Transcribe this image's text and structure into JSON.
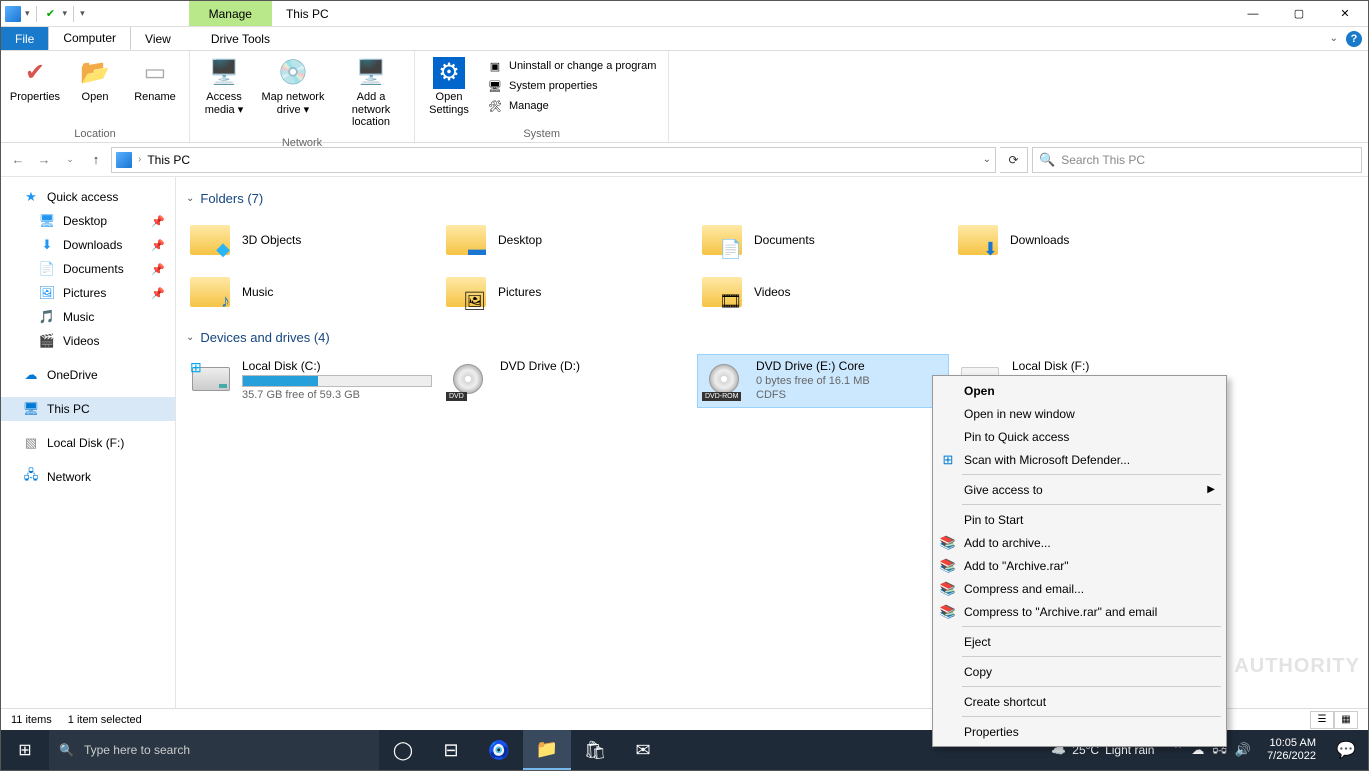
{
  "titlebar": {
    "manage": "Manage",
    "title": "This PC",
    "min": "—",
    "max": "▢",
    "close": "✕"
  },
  "tabs": {
    "file": "File",
    "computer": "Computer",
    "view": "View",
    "drivetools": "Drive Tools"
  },
  "ribbon": {
    "location": {
      "properties": "Properties",
      "open": "Open",
      "rename": "Rename",
      "label": "Location"
    },
    "network": {
      "access_media": "Access media ▾",
      "map_drive": "Map network drive ▾",
      "add_loc": "Add a network location",
      "label": "Network"
    },
    "settings": {
      "open_settings": "Open Settings"
    },
    "system": {
      "uninstall": "Uninstall or change a program",
      "props": "System properties",
      "manage": "Manage",
      "label": "System"
    }
  },
  "address": {
    "crumb": "This PC",
    "search_placeholder": "Search This PC"
  },
  "sidebar": {
    "quick_access": "Quick access",
    "desktop": "Desktop",
    "downloads": "Downloads",
    "documents": "Documents",
    "pictures": "Pictures",
    "music": "Music",
    "videos": "Videos",
    "onedrive": "OneDrive",
    "this_pc": "This PC",
    "local_f": "Local Disk (F:)",
    "network": "Network"
  },
  "sections": {
    "folders": "Folders (7)",
    "drives": "Devices and drives (4)"
  },
  "folders": {
    "objects3d": "3D Objects",
    "desktop": "Desktop",
    "documents": "Documents",
    "downloads": "Downloads",
    "music": "Music",
    "pictures": "Pictures",
    "videos": "Videos"
  },
  "drives": {
    "c": {
      "name": "Local Disk (C:)",
      "free": "35.7 GB free of 59.3 GB",
      "pct": 40
    },
    "d": {
      "name": "DVD Drive (D:)"
    },
    "e": {
      "name": "DVD Drive (E:) Core",
      "free": "0 bytes free of 16.1 MB",
      "fs": "CDFS"
    },
    "f": {
      "name": "Local Disk (F:)"
    }
  },
  "context_menu": {
    "open": "Open",
    "open_new": "Open in new window",
    "pin_quick": "Pin to Quick access",
    "defender": "Scan with Microsoft Defender...",
    "give_access": "Give access to",
    "pin_start": "Pin to Start",
    "add_archive": "Add to archive...",
    "add_rar": "Add to \"Archive.rar\"",
    "compress_email": "Compress and email...",
    "compress_rar_email": "Compress to \"Archive.rar\" and email",
    "eject": "Eject",
    "copy": "Copy",
    "create_shortcut": "Create shortcut",
    "properties": "Properties"
  },
  "status": {
    "items": "11 items",
    "selected": "1 item selected"
  },
  "taskbar": {
    "search": "Type here to search",
    "weather_temp": "25°C",
    "weather_cond": "Light rain",
    "time": "10:05 AM",
    "date": "7/26/2022"
  },
  "watermark": "ANDROID AUTHORITY"
}
